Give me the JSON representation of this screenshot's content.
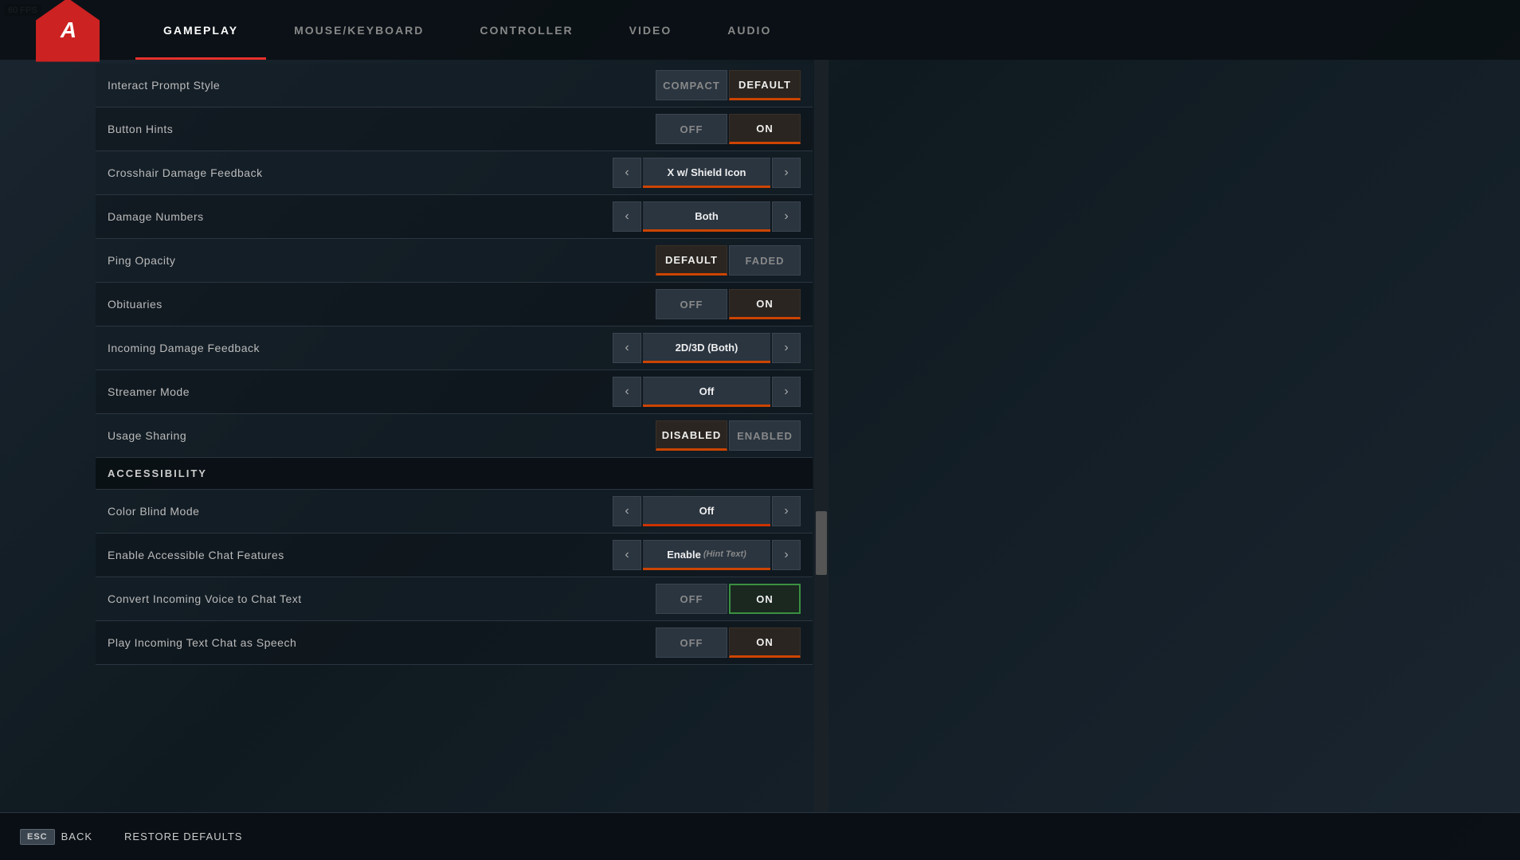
{
  "fps": "60 FPS",
  "logo": "A",
  "nav": {
    "tabs": [
      {
        "id": "gameplay",
        "label": "GAMEPLAY",
        "active": true
      },
      {
        "id": "mouse_keyboard",
        "label": "MOUSE/KEYBOARD",
        "active": false
      },
      {
        "id": "controller",
        "label": "CONTROLLER",
        "active": false
      },
      {
        "id": "video",
        "label": "VIDEO",
        "active": false
      },
      {
        "id": "audio",
        "label": "AUDIO",
        "active": false
      }
    ]
  },
  "settings": {
    "rows": [
      {
        "id": "interact_prompt_style",
        "label": "Interact Prompt Style",
        "control_type": "toggle2",
        "option1": "Compact",
        "option2": "Default",
        "active": "option2"
      },
      {
        "id": "button_hints",
        "label": "Button Hints",
        "control_type": "toggle2",
        "option1": "Off",
        "option2": "On",
        "active": "option2"
      },
      {
        "id": "crosshair_damage_feedback",
        "label": "Crosshair Damage Feedback",
        "control_type": "arrow_selector",
        "value": "X w/ Shield Icon"
      },
      {
        "id": "damage_numbers",
        "label": "Damage Numbers",
        "control_type": "arrow_selector",
        "value": "Both"
      },
      {
        "id": "ping_opacity",
        "label": "Ping Opacity",
        "control_type": "toggle2",
        "option1": "Default",
        "option2": "Faded",
        "active": "option1"
      },
      {
        "id": "obituaries",
        "label": "Obituaries",
        "control_type": "toggle2",
        "option1": "Off",
        "option2": "On",
        "active": "option2"
      },
      {
        "id": "incoming_damage_feedback",
        "label": "Incoming Damage Feedback",
        "control_type": "arrow_selector",
        "value": "2D/3D (Both)"
      },
      {
        "id": "streamer_mode",
        "label": "Streamer Mode",
        "control_type": "arrow_selector",
        "value": "Off"
      },
      {
        "id": "usage_sharing",
        "label": "Usage Sharing",
        "control_type": "toggle2",
        "option1": "Disabled",
        "option2": "Enabled",
        "active": "option1"
      }
    ],
    "accessibility_section": "ACCESSIBILITY",
    "accessibility_rows": [
      {
        "id": "color_blind_mode",
        "label": "Color Blind Mode",
        "control_type": "arrow_selector",
        "value": "Off",
        "has_color_bar": true
      },
      {
        "id": "accessible_chat_features",
        "label": "Enable Accessible Chat Features",
        "control_type": "arrow_selector",
        "value": "Enable",
        "hint": "(Hint Text)"
      },
      {
        "id": "convert_incoming_voice",
        "label": "Convert Incoming Voice to Chat Text",
        "control_type": "toggle2",
        "option1": "Off",
        "option2": "On",
        "active": "option2",
        "active_style": "green"
      },
      {
        "id": "play_incoming_text",
        "label": "Play Incoming Text Chat as Speech",
        "control_type": "toggle2",
        "option1": "Off",
        "option2": "On",
        "active": "option2"
      }
    ]
  },
  "bottom": {
    "back_key": "ESC",
    "back_label": "Back",
    "restore_label": "Restore Defaults"
  }
}
